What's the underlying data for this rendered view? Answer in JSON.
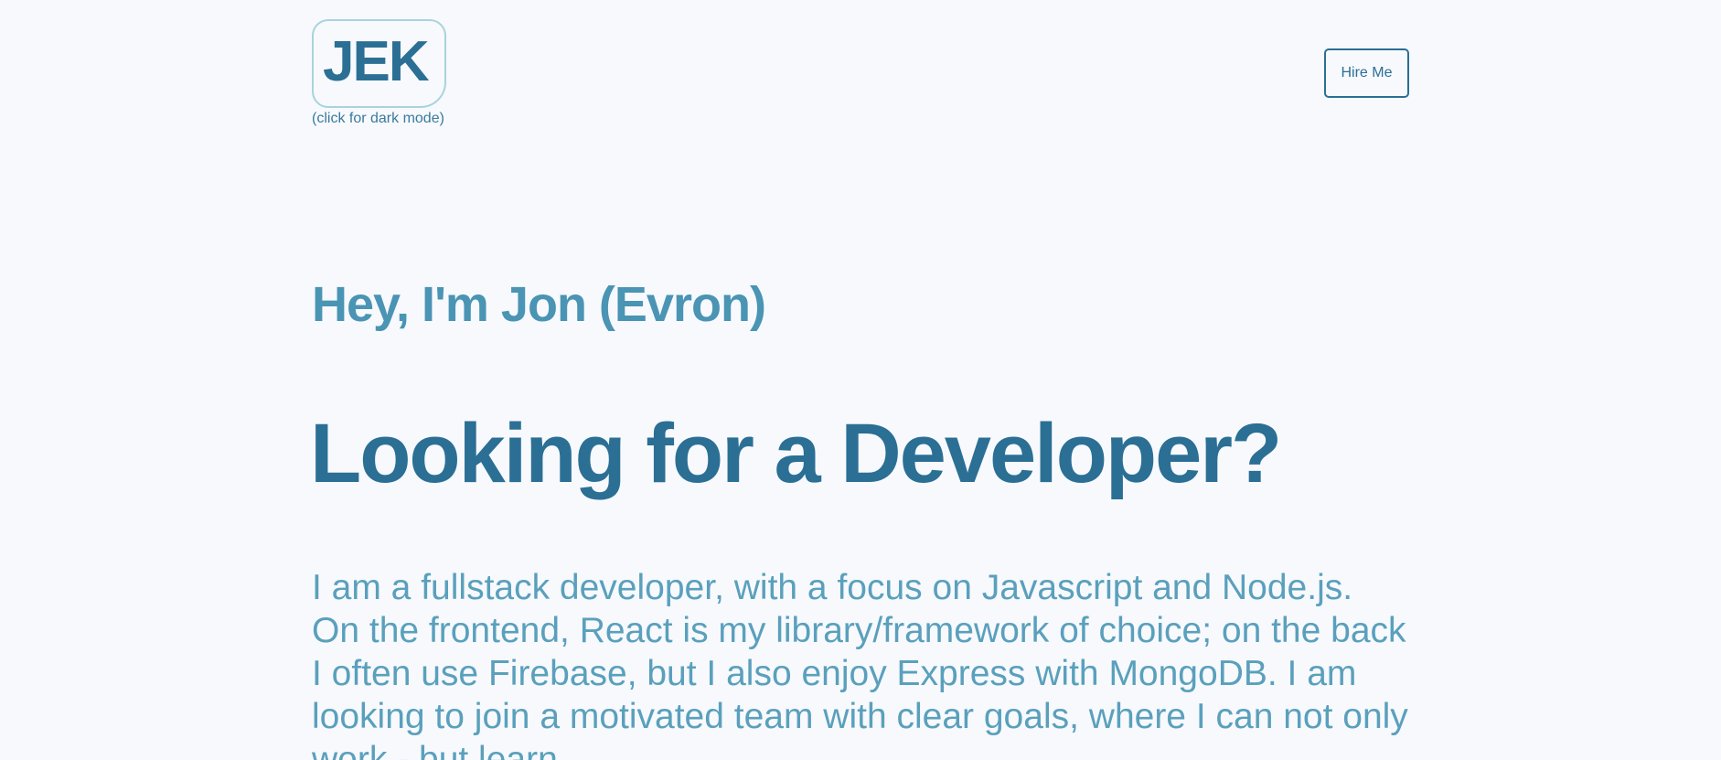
{
  "header": {
    "logo_text": "JEK",
    "logo_hint": "(click for dark mode)",
    "hire_label": "Hire Me"
  },
  "hero": {
    "greeting": "Hey, I'm Jon (Evron)",
    "headline": "Looking for a Developer?",
    "intro": "I am a fullstack developer, with a focus on Javascript and Node.js. On the frontend, React is my library/framework of choice; on the back I often use Firebase, but I also enjoy Express with MongoDB. I am looking to join a motivated team with clear goals, where I can not only work - but learn."
  },
  "colors": {
    "background": "#f7f9fd",
    "primary": "#2b6f94",
    "secondary": "#4a94b4",
    "body_text": "#5aa0bc",
    "logo_border": "#a9d3dc"
  }
}
